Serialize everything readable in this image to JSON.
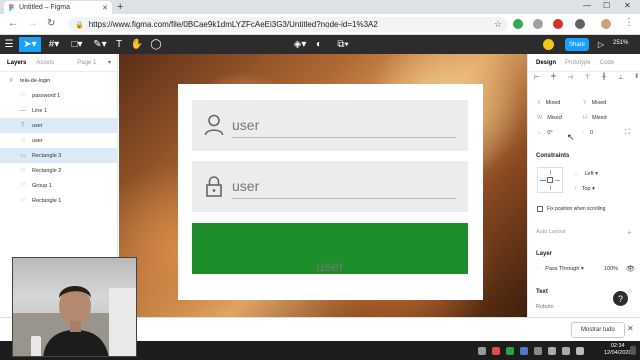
{
  "browser": {
    "tab_title": "Untitled – Figma",
    "url": "https://www.figma.com/file/0BCae9k1dmLYZFcAeEi3G3/Untitled?node-id=1%3A2"
  },
  "toolbar": {
    "share_label": "Share",
    "zoom_label": "251%"
  },
  "layers_panel": {
    "tab_layers": "Layers",
    "tab_assets": "Assets",
    "page_label": "Page 1",
    "items": [
      {
        "label": "tela-de-login",
        "icon": "frame-icon",
        "selected": false,
        "indent": 0
      },
      {
        "label": "password 1",
        "icon": "component-icon",
        "selected": false,
        "indent": 1
      },
      {
        "label": "Line 1",
        "icon": "line-icon",
        "selected": false,
        "indent": 1
      },
      {
        "label": "user",
        "icon": "text-icon",
        "selected": true,
        "indent": 1
      },
      {
        "label": "user",
        "icon": "component-icon",
        "selected": false,
        "indent": 1
      },
      {
        "label": "Rectangle 3",
        "icon": "rectangle-icon",
        "selected": true,
        "indent": 1
      },
      {
        "label": "Rectangle 2",
        "icon": "component-icon",
        "selected": false,
        "indent": 1
      },
      {
        "label": "Group 1",
        "icon": "component-icon",
        "selected": false,
        "indent": 1
      },
      {
        "label": "Rectangle 1",
        "icon": "component-icon",
        "selected": false,
        "indent": 1
      }
    ]
  },
  "canvas": {
    "field1_text": "user",
    "field2_text": "user",
    "button_text": "user",
    "button_color": "#1e8e2c"
  },
  "design_panel": {
    "tab_design": "Design",
    "tab_prototype": "Prototype",
    "tab_code": "Code",
    "x_label": "X",
    "x_value": "Mixed",
    "y_label": "Y",
    "y_value": "Mixed",
    "w_label": "W",
    "w_value": "Mixed",
    "h_label": "H",
    "h_value": "Mixed",
    "rotation_value": "0°",
    "radius_value": "0",
    "constraints_title": "Constraints",
    "constraint_h": "Left",
    "constraint_v": "Top",
    "fix_position_label": "Fix position when scrolling",
    "auto_layout_label": "Auto Layout",
    "layer_title": "Layer",
    "blend_mode": "Pass Through",
    "opacity": "100%",
    "text_title": "Text",
    "font_name": "Roboto"
  },
  "downloads": {
    "show_all_label": "Mostrar tudo"
  },
  "taskbar": {
    "time": "02:34",
    "date": "12/04/2020"
  },
  "colors": {
    "figma_blue": "#18a0fb",
    "figma_dark": "#2c2c2c"
  }
}
